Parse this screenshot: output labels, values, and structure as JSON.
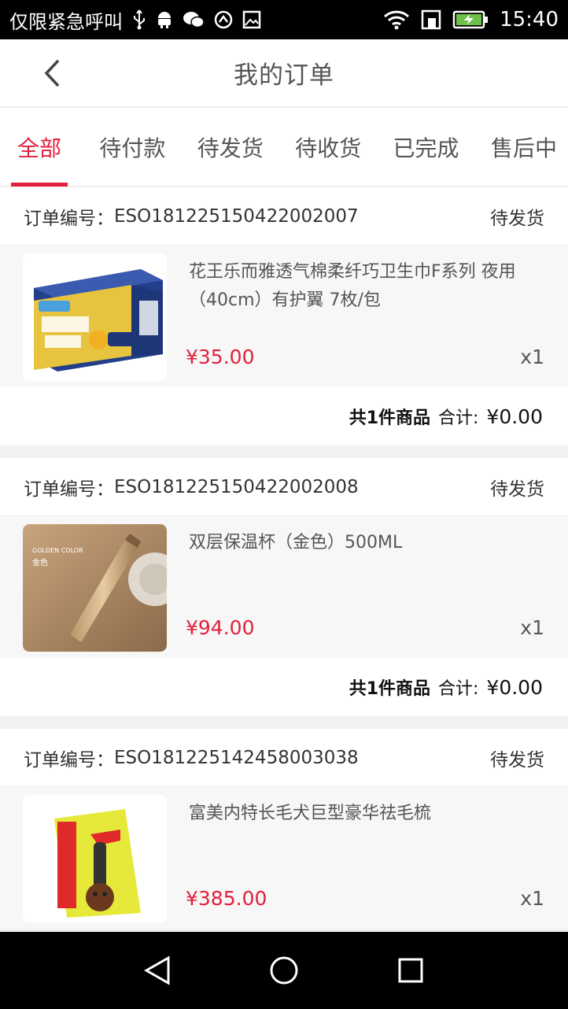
{
  "status_bar": {
    "carrier": "仅限紧急呼叫",
    "time": "15:40",
    "icons": [
      "usb-icon",
      "android-icon",
      "wechat-icon",
      "sync-icon",
      "image-icon",
      "wifi-icon",
      "sim-icon",
      "battery-charging-icon"
    ]
  },
  "header": {
    "title": "我的订单",
    "back_icon": "chevron-left-icon"
  },
  "tabs": [
    {
      "label": "全部",
      "active": true
    },
    {
      "label": "待付款",
      "active": false
    },
    {
      "label": "待发货",
      "active": false
    },
    {
      "label": "待收货",
      "active": false
    },
    {
      "label": "已完成",
      "active": false
    },
    {
      "label": "售后中",
      "active": false
    }
  ],
  "orders": [
    {
      "no_label": "订单编号：",
      "no": "ESO181225150422002007",
      "status": "待发货",
      "item": {
        "name": "花王乐而雅透气棉柔纤巧卫生巾F系列  夜用（40cm）有护翼 7枚/包",
        "price": "¥35.00",
        "qty": "x1",
        "thumb_icon": "sanitary-pad-box-image"
      },
      "count": "共1件商品",
      "total_label": "合计:",
      "total": "¥0.00"
    },
    {
      "no_label": "订单编号：",
      "no": "ESO181225150422002008",
      "status": "待发货",
      "item": {
        "name": "双层保温杯（金色）500ML",
        "price": "¥94.00",
        "qty": "x1",
        "thumb_icon": "gold-thermos-image",
        "thumb_text_1": "GOLDEN COLOR",
        "thumb_text_2": "金色"
      },
      "count": "共1件商品",
      "total_label": "合计:",
      "total": "¥0.00"
    },
    {
      "no_label": "订单编号：",
      "no": "ESO181225142458003038",
      "status": "待发货",
      "item": {
        "name": "富美内特长毛犬巨型豪华祛毛梳",
        "price": "¥385.00",
        "qty": "x1",
        "thumb_icon": "deshedding-comb-image"
      }
    }
  ],
  "nav_bar": {
    "icons": [
      "back-triangle-icon",
      "home-circle-icon",
      "recents-square-icon"
    ]
  },
  "colors": {
    "accent": "#e3203c",
    "background": "#f2f2f2"
  }
}
